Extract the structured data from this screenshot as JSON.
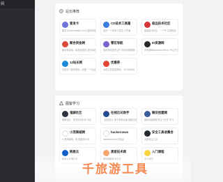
{
  "sidebar": {
    "brand": "网"
  },
  "section_top": {
    "title": "站长推荐",
    "tiles": [
      {
        "name": "爱发卡",
        "desc": "爱发卡(www.aipay1.com)\n国内优质发卡平台！",
        "logo_color": "#6e74d8"
      },
      {
        "name": "CD技术工具箱",
        "desc": "站长一个单页人员的\n工作者",
        "logo_color": "#3b7ddd"
      },
      {
        "name": "极品技术社区",
        "desc": "极品技术社区，一个专\n注网络技",
        "logo_color": "#d4343a"
      },
      {
        "name": "聚合资金网",
        "desc": "聚合资金网，精准优质的\n站长网站",
        "logo_color": "#d84b3d"
      },
      {
        "name": "雪花导航",
        "desc": "雪花导航是专注于\n网址导航推荐",
        "logo_color": "#7d62cd"
      },
      {
        "name": "ID资源网",
        "desc": "ID资源网www.idoo789.cn\n专注于技术网络技",
        "logo_color": "#2a2a2a"
      },
      {
        "name": "12站长网",
        "desc": "仅供学习参考网站，收藏\n一个站点",
        "logo_color": "#1c8ad8"
      },
      {
        "name": "优惠券",
        "desc": "为你立刻发现商场，\n917603081",
        "logo_color": "#e64534"
      }
    ]
  },
  "section_bottom": {
    "title": "图客学习",
    "tiles": [
      {
        "name": "鬼脚社区",
        "desc": "鬼脚社区，是学技术分享\n社区",
        "logo_color": "#2e3440"
      },
      {
        "name": "在线比对助手",
        "desc": "【在线比】用于带着全面\n视频文件的",
        "logo_color": "#244a8f"
      },
      {
        "name": "微安创建网",
        "desc": "微安创建网是专注于分享\n学习",
        "logo_color": "#3c5a99"
      },
      {
        "name": "小茂商城网",
        "desc": "小茂商城网，搜\n索更多分享",
        "logo_color": "#ffffff"
      },
      {
        "name": "hackernews",
        "desc": "hackernews公开信息",
        "logo_color": "#ffffff"
      },
      {
        "name": "安全工具收集合",
        "desc": "大量安全工具",
        "logo_color": "#24292e"
      },
      {
        "name": "网易云",
        "desc": "网易公开课平台",
        "logo_color": "#0f60c6"
      },
      {
        "name": "黑客技术网",
        "desc": "网络编程技术交流",
        "logo_color": "#f3a56c"
      },
      {
        "name": "入门课程",
        "desc": "学习资料",
        "logo_color": "#f9d342"
      }
    ]
  },
  "overlay": {
    "title": "千旅游工具"
  },
  "colors": {
    "sidebar_bg": "#2b2c31",
    "page_bg": "#f1f2f4",
    "accent": "#f48a52"
  }
}
